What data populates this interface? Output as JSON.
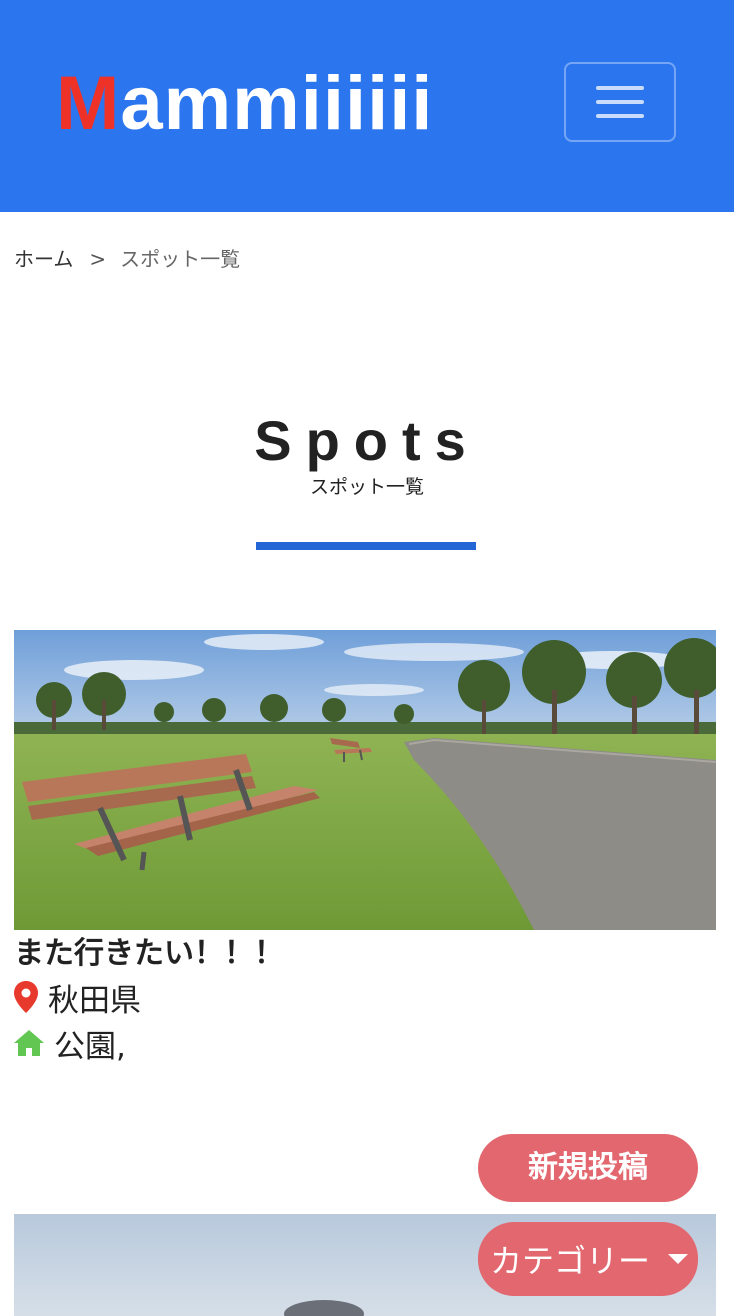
{
  "header": {
    "logo_first": "M",
    "logo_rest": "ammiiiiii",
    "menu_icon": "hamburger-icon",
    "bg_color": "#2b76ee",
    "logo_accent_color": "#ee3228"
  },
  "breadcrumb": {
    "home": "ホーム",
    "separator": ">",
    "current": "スポット一覧"
  },
  "section": {
    "title": "Spots",
    "subtitle": "スポット一覧",
    "rule_color": "#2566d6"
  },
  "spots": [
    {
      "title": "また行きたい！！！",
      "prefecture": "秋田県",
      "category": "公園,",
      "location_icon": "map-pin-icon",
      "category_icon": "home-icon"
    }
  ],
  "actions": {
    "new_post": "新規投稿",
    "category": "カテゴリー",
    "button_color": "#e2676f"
  }
}
